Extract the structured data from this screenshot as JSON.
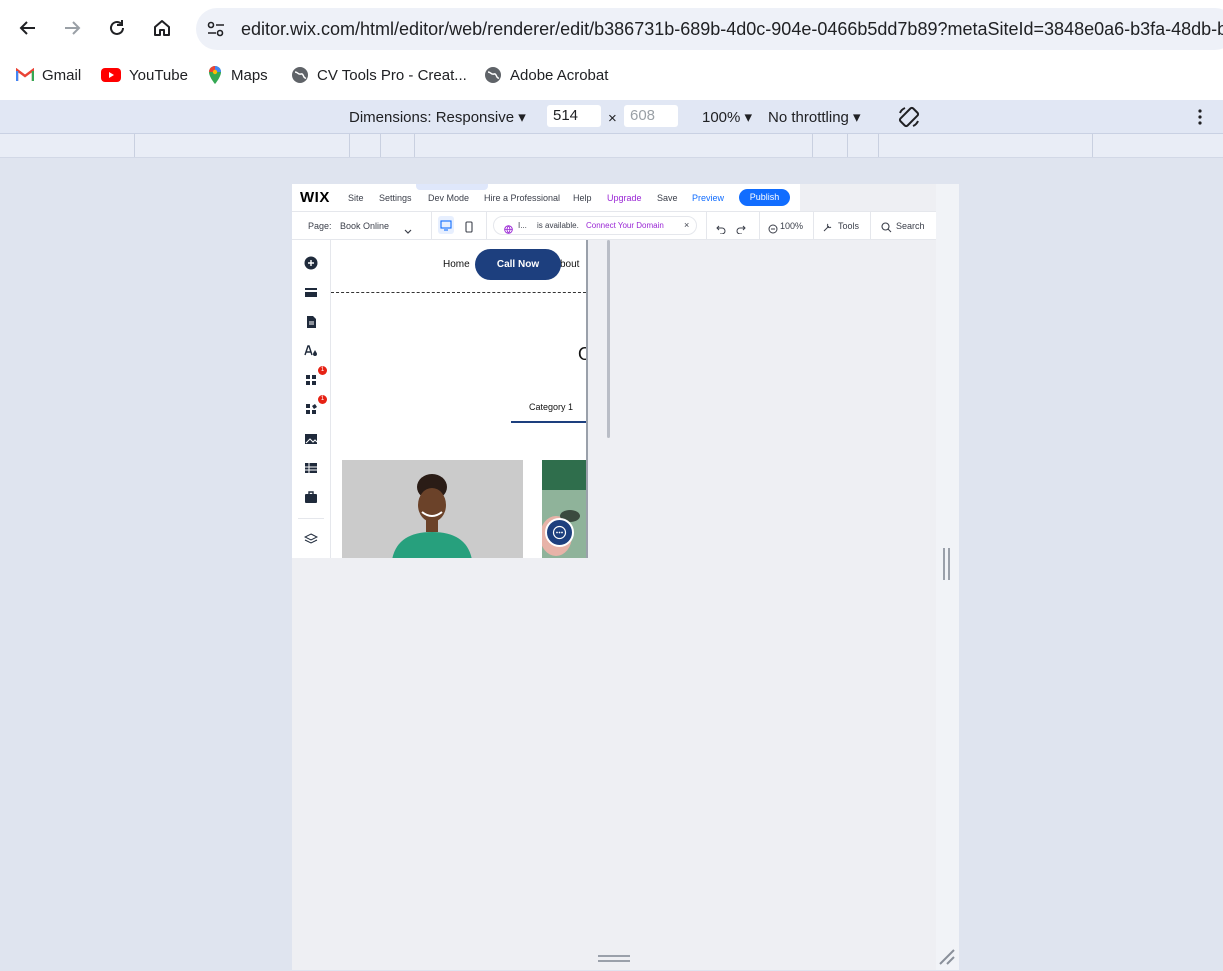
{
  "browser": {
    "url": "editor.wix.com/html/editor/web/renderer/edit/b386731b-689b-4d0c-904e-0466b5dd7b89?metaSiteId=3848e0a6-b3fa-48db-bc",
    "bookmarks": [
      "Gmail",
      "YouTube",
      "Maps",
      "CV Tools Pro - Creat...",
      "Adobe Acrobat"
    ]
  },
  "devtools": {
    "dimensions_label": "Dimensions: Responsive",
    "width": "514",
    "height_placeholder": "608",
    "times": "×",
    "zoom": "100%",
    "throttling": "No throttling"
  },
  "wix": {
    "logo": "WIX",
    "menu": [
      "Site",
      "Settings",
      "Dev Mode",
      "Hire a Professional",
      "Help",
      "Upgrade",
      "Save",
      "Preview"
    ],
    "publish": "Publish",
    "page_label": "Page:",
    "page_value": "Book Online",
    "domain_prefix": "I...",
    "domain_available": "is available.",
    "connect_domain": "Connect Your Domain",
    "close": "×",
    "zoom": "100%",
    "tools": "Tools",
    "search": "Search",
    "colors": {
      "accent": "#116dff",
      "upgrade": "#9a27d5",
      "button": "#1d3f7e"
    }
  },
  "site": {
    "nav_home": "Home",
    "nav_about": "bout",
    "call_now": "Call Now",
    "heading_fragment": "O",
    "category_tab": "Category 1"
  }
}
